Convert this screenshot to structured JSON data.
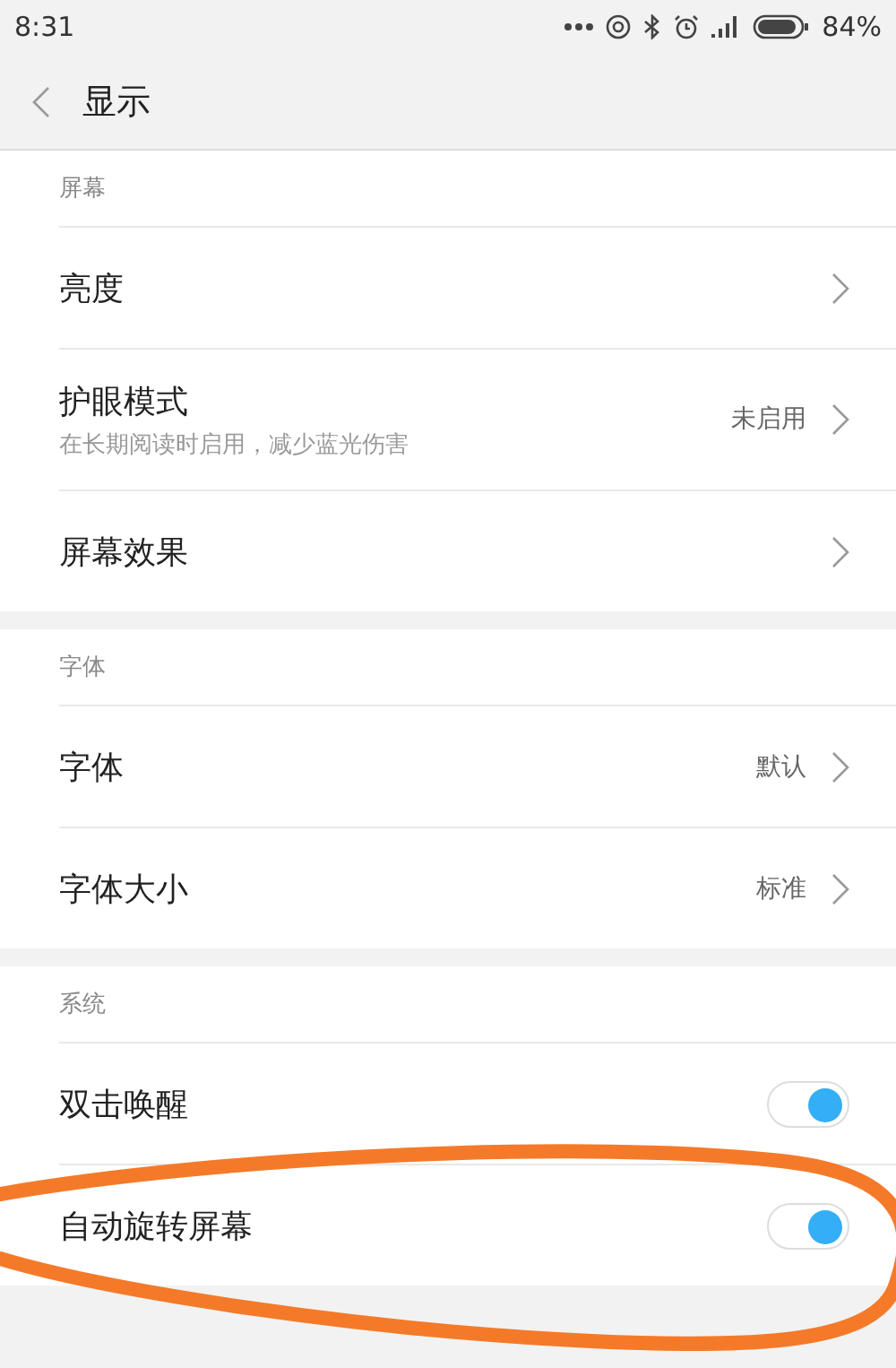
{
  "status_bar": {
    "time": "8:31",
    "battery": "84%"
  },
  "header": {
    "title": "显示"
  },
  "sections": [
    {
      "title": "屏幕",
      "items": [
        {
          "kind": "nav",
          "label": "亮度"
        },
        {
          "kind": "nav",
          "label": "护眼模式",
          "subtitle": "在长期阅读时启用，减少蓝光伤害",
          "value": "未启用"
        },
        {
          "kind": "nav",
          "label": "屏幕效果"
        }
      ]
    },
    {
      "title": "字体",
      "items": [
        {
          "kind": "nav",
          "label": "字体",
          "value": "默认"
        },
        {
          "kind": "nav",
          "label": "字体大小",
          "value": "标准"
        }
      ]
    },
    {
      "title": "系统",
      "items": [
        {
          "kind": "toggle",
          "label": "双击唤醒",
          "on": true
        },
        {
          "kind": "toggle",
          "label": "自动旋转屏幕",
          "on": true
        }
      ]
    }
  ]
}
